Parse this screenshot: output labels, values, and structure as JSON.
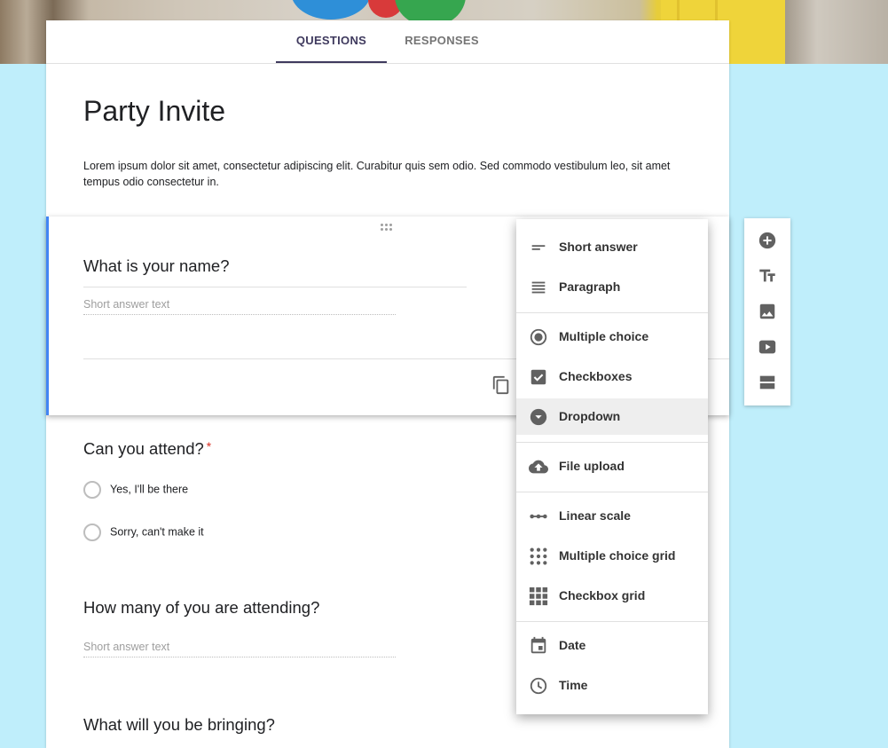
{
  "tabs": [
    {
      "label": "QUESTIONS",
      "active": true
    },
    {
      "label": "RESPONSES",
      "active": false
    }
  ],
  "form": {
    "title": "Party Invite",
    "description": "Lorem ipsum dolor sit amet, consectetur adipiscing elit. Curabitur quis sem odio. Sed commodo vestibulum leo, sit amet tempus odio consectetur in."
  },
  "questions": [
    {
      "title": "What is your name?",
      "placeholder": "Short answer text"
    },
    {
      "title": "Can you attend?",
      "required_mark": "*",
      "options": [
        "Yes,  I'll be there",
        "Sorry, can't make it"
      ]
    },
    {
      "title": "How many of you are attending?",
      "placeholder": "Short answer text"
    },
    {
      "title": "What will you be bringing?"
    }
  ],
  "menu": {
    "items": [
      {
        "label": "Short answer",
        "icon": "short-answer-icon"
      },
      {
        "label": "Paragraph",
        "icon": "paragraph-icon"
      },
      {
        "label": "Multiple choice",
        "icon": "radio-icon"
      },
      {
        "label": "Checkboxes",
        "icon": "checkbox-icon"
      },
      {
        "label": "Dropdown",
        "icon": "dropdown-icon",
        "selected": true
      },
      {
        "label": "File upload",
        "icon": "cloud-upload-icon"
      },
      {
        "label": "Linear scale",
        "icon": "linear-scale-icon"
      },
      {
        "label": "Multiple choice grid",
        "icon": "dot-grid-icon"
      },
      {
        "label": "Checkbox grid",
        "icon": "square-grid-icon"
      },
      {
        "label": "Date",
        "icon": "calendar-icon"
      },
      {
        "label": "Time",
        "icon": "clock-icon"
      }
    ]
  },
  "toolbar": {
    "icons": [
      "add-question-icon",
      "title-text-icon",
      "image-icon",
      "video-icon",
      "section-icon"
    ]
  },
  "colors": {
    "background": "#bfeefb",
    "accent": "#3f3a5e",
    "active_bar": "#4285f4",
    "required": "#d93025",
    "icon": "#616161"
  }
}
